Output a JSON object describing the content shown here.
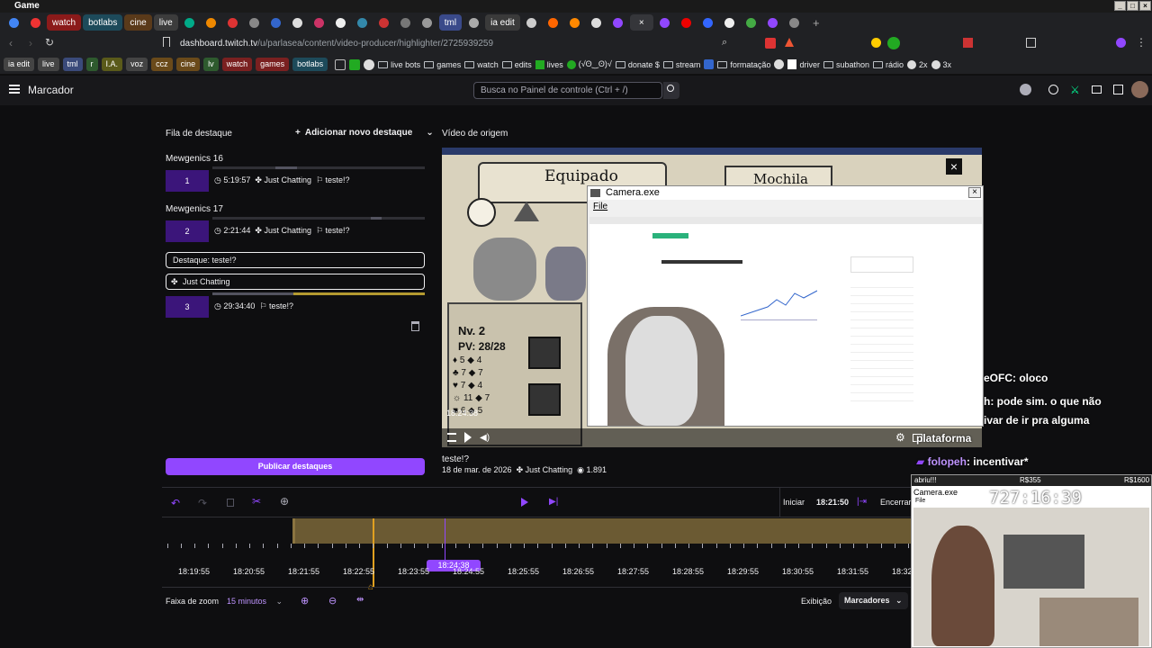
{
  "window": {
    "title": "Game"
  },
  "tabs": [
    {
      "label": "watch",
      "bg": "#8b1a1a"
    },
    {
      "label": "botlabs",
      "bg": "#1d4a5a"
    },
    {
      "label": "cine",
      "bg": "#5a3a1a"
    },
    {
      "label": "live",
      "bg": "#3c3c3c"
    },
    {
      "label": "tml",
      "bg": "#3a4a8a"
    },
    {
      "label": "ia edit",
      "bg": "#3a3a3a"
    }
  ],
  "address": {
    "host": "dashboard.twitch.tv",
    "path": "/u/parlasea/content/video-producer/highlighter/2725939259"
  },
  "bookmarks": {
    "chips": [
      {
        "label": "ia edit",
        "bg": "#444"
      },
      {
        "label": "live",
        "bg": "#444"
      },
      {
        "label": "tml",
        "bg": "#3a4a7a"
      },
      {
        "label": "r",
        "bg": "#2e5a2e"
      },
      {
        "label": "I.A.",
        "bg": "#5a5a1a"
      },
      {
        "label": "voz",
        "bg": "#444"
      },
      {
        "label": "ccz",
        "bg": "#6a4a1a"
      },
      {
        "label": "cine",
        "bg": "#6a4a1a"
      },
      {
        "label": "lv",
        "bg": "#2e5a2e"
      },
      {
        "label": "watch",
        "bg": "#7a2020"
      },
      {
        "label": "games",
        "bg": "#7a2020"
      },
      {
        "label": "botlabs",
        "bg": "#1d4a5a"
      }
    ],
    "items": [
      "live bots",
      "games",
      "watch",
      "edits",
      "lives",
      "(√ʘ‿ʘ)√",
      "donate $",
      "stream",
      "formatação",
      "driver",
      "subathon",
      "rádio",
      "2x",
      "3x"
    ]
  },
  "twitch": {
    "page_title": "Marcador",
    "search_placeholder": "Busca no Painel de controle (Ctrl + /)"
  },
  "left": {
    "queue_label": "Fila de destaque",
    "add_label": "Adicionar novo destaque",
    "groups": [
      {
        "title": "Mewgenics 16",
        "num": "1",
        "time": "5:19:57",
        "category": "Just Chatting",
        "name": "teste!?"
      },
      {
        "title": "Mewgenics 17",
        "num": "2",
        "time": "2:21:44",
        "category": "Just Chatting",
        "name": "teste!?"
      }
    ],
    "active": {
      "title_field": "Destaque: teste!?",
      "category_field": "Just Chatting",
      "num": "3",
      "time": "29:34:40",
      "name": "teste!?"
    },
    "publish": "Publicar destaques"
  },
  "video": {
    "source_label": "Vídeo de origem",
    "game_text_1": "Equipado",
    "game_text_2": "Mochila",
    "game_text_3": "Nv. 2",
    "game_text_4": "PV: 28/28",
    "cam_title": "Camera.exe",
    "cam_menu": "File",
    "timestamp": "18:24:38",
    "caption_title": "teste!?",
    "caption_date": "18 de mar. de 2026",
    "caption_category": "Just Chatting",
    "caption_views": "1.891"
  },
  "timeline": {
    "start_label": "Iniciar",
    "start_time": "18:21:50",
    "end_label": "Encerrar",
    "ticks": [
      "18:19:55",
      "18:20:55",
      "18:21:55",
      "18:22:55",
      "18:23:55",
      "18:24:55",
      "18:25:55",
      "18:26:55",
      "18:27:55",
      "18:28:55",
      "18:29:55",
      "18:30:55",
      "18:31:55",
      "18:32"
    ],
    "playhead": "18:24:38",
    "zoom_label": "Faixa de zoom",
    "zoom_value": "15 minutos",
    "display_label": "Exibição",
    "display_value": "Marcadores"
  },
  "chat": [
    {
      "user": "eOFC",
      "msg": ": oloco"
    },
    {
      "user": "h",
      "msg": ":  pode sim. o que não"
    },
    {
      "user": "",
      "msg": "ivar de ir pra alguma"
    },
    {
      "user": "",
      "msg": "plataforma"
    },
    {
      "user": "folopeh",
      "msg": ": incentivar*"
    }
  ],
  "cam2": {
    "bar_left": "abriu!!!",
    "bar_mid": "R$355",
    "bar_right": "R$1600",
    "title": "Camera.exe",
    "menu": "File",
    "counter": "727:16:39"
  }
}
